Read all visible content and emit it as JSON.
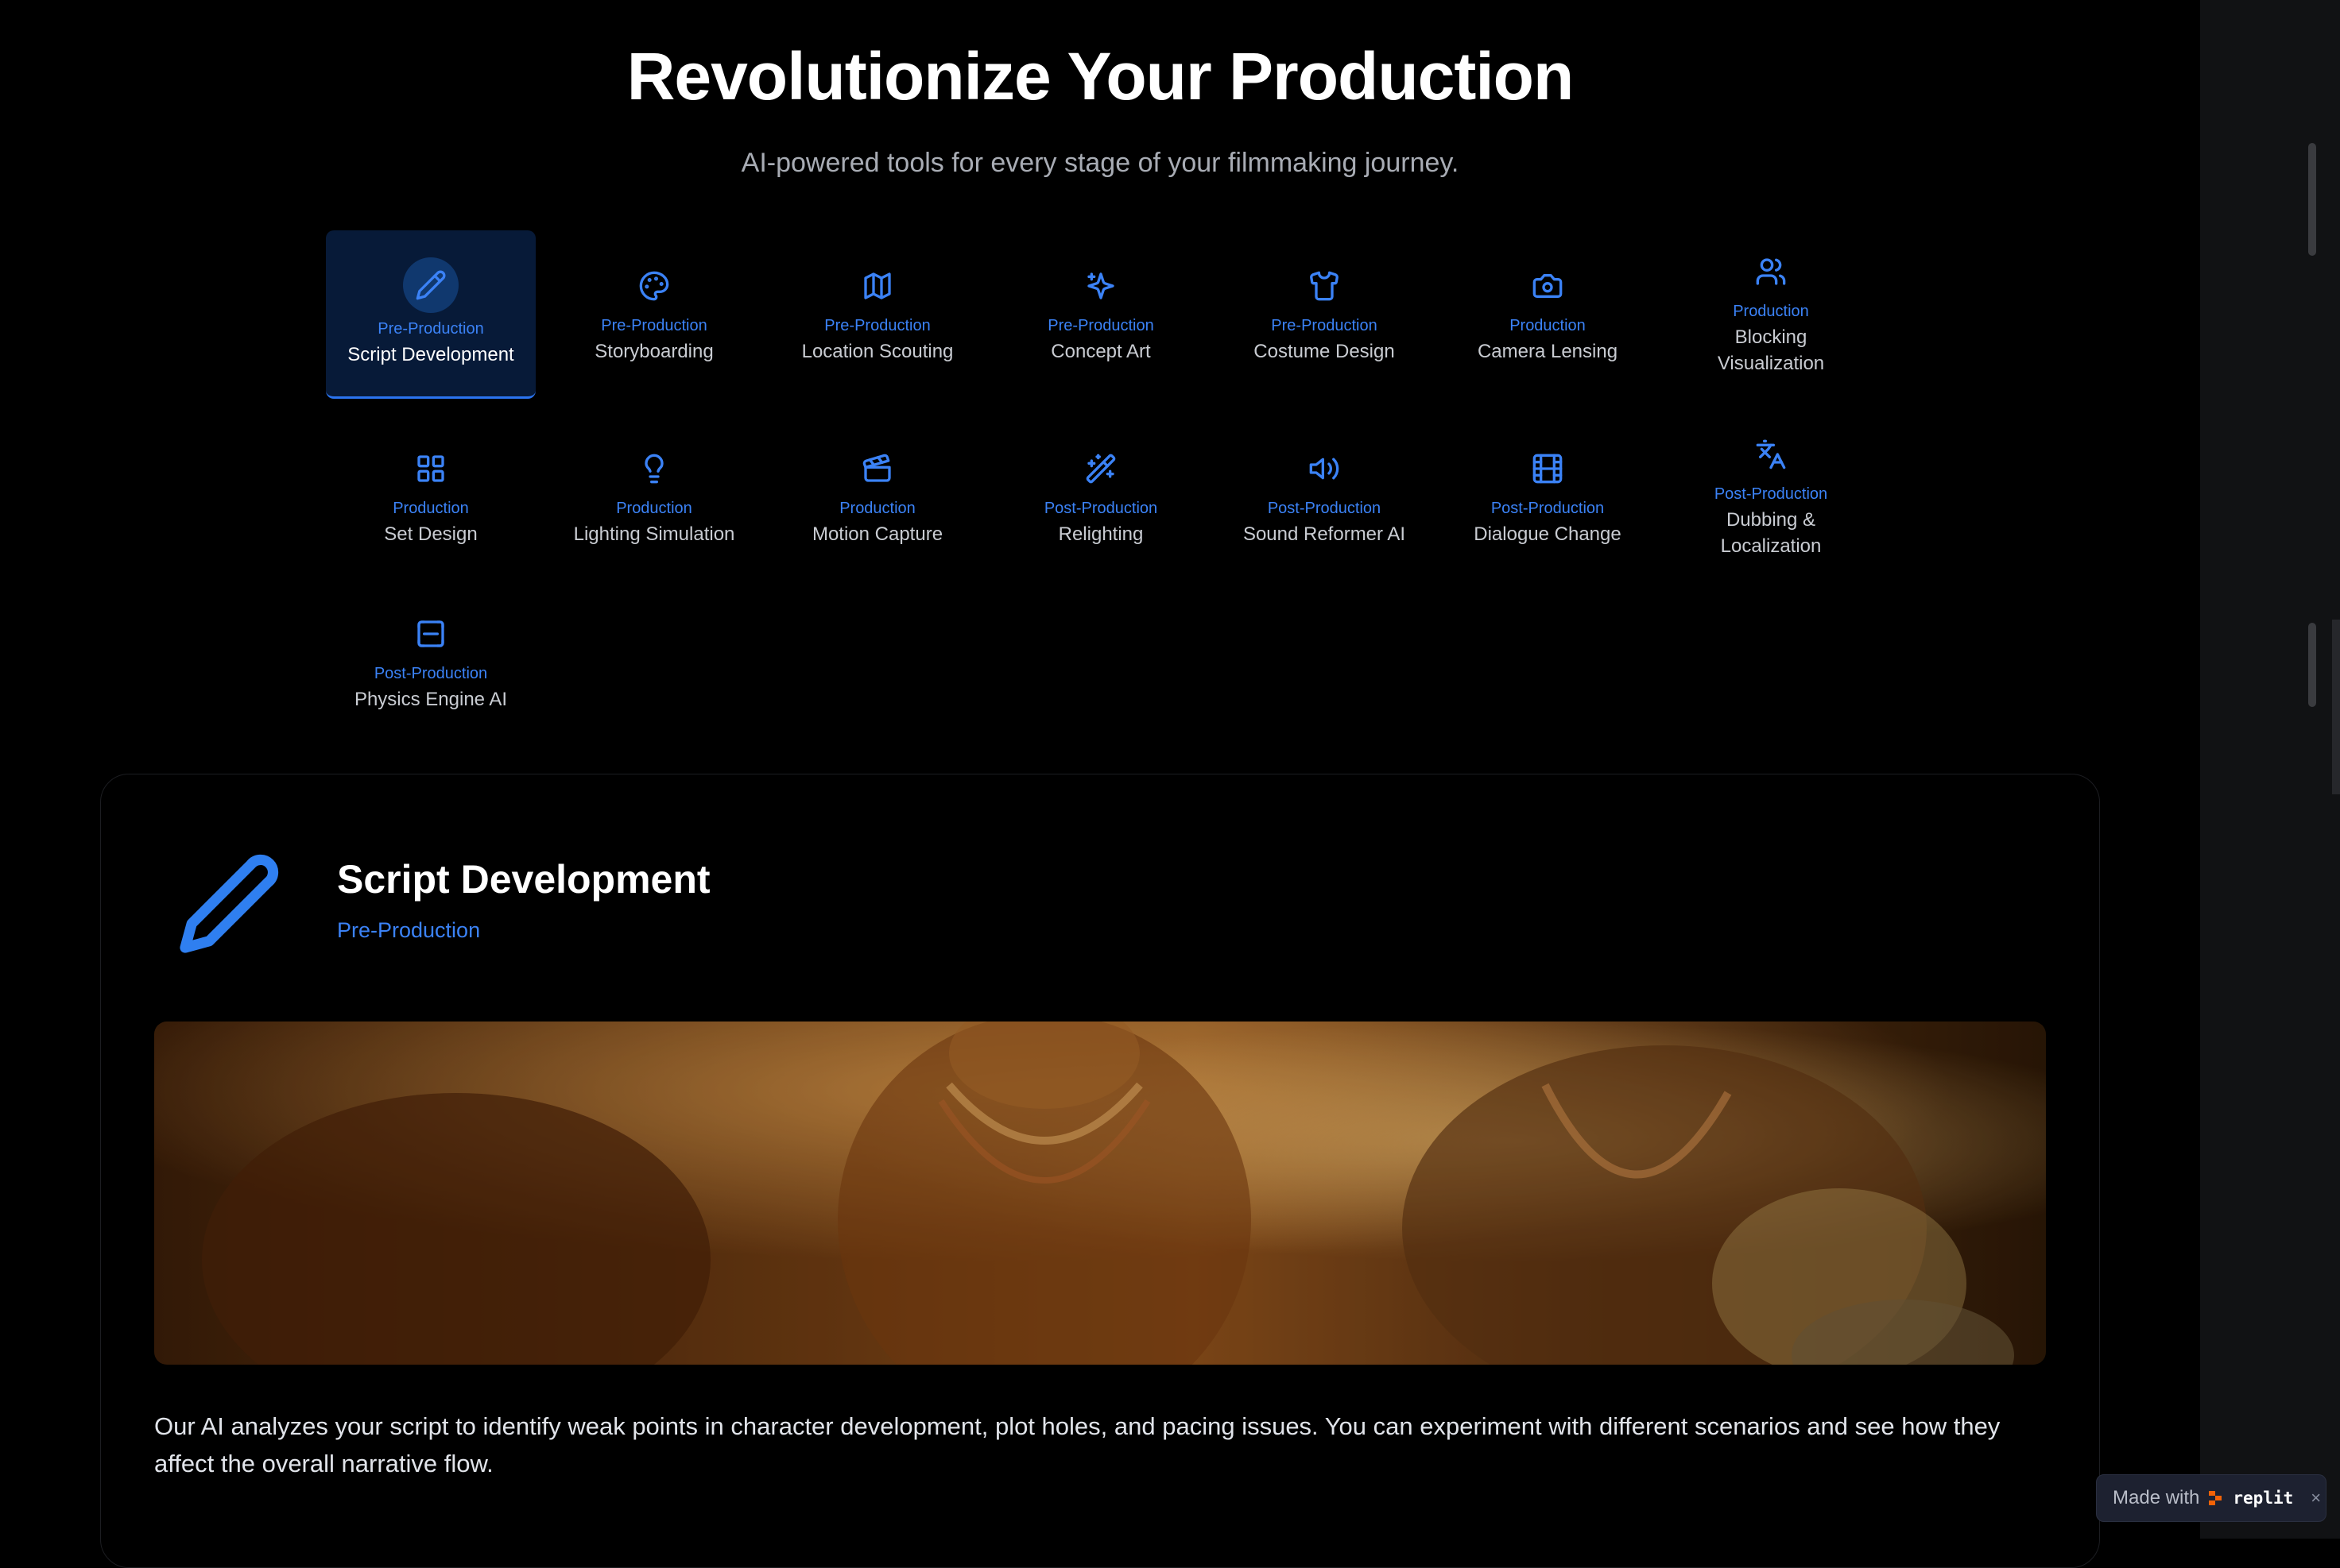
{
  "header": {
    "title": "Revolutionize Your Production",
    "subtitle": "AI-powered tools for every stage of your filmmaking journey."
  },
  "tools": [
    {
      "stage": "Pre-Production",
      "name": "Script Development",
      "icon": "pencil-icon",
      "active": true
    },
    {
      "stage": "Pre-Production",
      "name": "Storyboarding",
      "icon": "palette-icon"
    },
    {
      "stage": "Pre-Production",
      "name": "Location Scouting",
      "icon": "map-icon"
    },
    {
      "stage": "Pre-Production",
      "name": "Concept Art",
      "icon": "sparkles-icon"
    },
    {
      "stage": "Pre-Production",
      "name": "Costume Design",
      "icon": "shirt-icon"
    },
    {
      "stage": "Production",
      "name": "Camera Lensing",
      "icon": "camera-icon"
    },
    {
      "stage": "Production",
      "name": "Blocking Visualization",
      "icon": "users-icon"
    },
    {
      "stage": "Production",
      "name": "Set Design",
      "icon": "grid-icon"
    },
    {
      "stage": "Production",
      "name": "Lighting Simulation",
      "icon": "lightbulb-icon"
    },
    {
      "stage": "Production",
      "name": "Motion Capture",
      "icon": "clapperboard-icon"
    },
    {
      "stage": "Post-Production",
      "name": "Relighting",
      "icon": "magic-wand-icon"
    },
    {
      "stage": "Post-Production",
      "name": "Sound Reformer AI",
      "icon": "volume-icon"
    },
    {
      "stage": "Post-Production",
      "name": "Dialogue Change",
      "icon": "film-icon"
    },
    {
      "stage": "Post-Production",
      "name": "Dubbing & Localization",
      "icon": "languages-icon"
    },
    {
      "stage": "Post-Production",
      "name": "Physics Engine AI",
      "icon": "scan-icon"
    }
  ],
  "detail": {
    "title": "Script Development",
    "stage": "Pre-Production",
    "icon": "pencil-icon",
    "image_alt": "cinematic-still",
    "description": "Our AI analyzes your script to identify weak points in character development, plot holes, and pacing issues. You can experiment with different scenarios and see how they affect the overall narrative flow."
  },
  "badge": {
    "made_with": "Made with",
    "brand": "replit",
    "close": "×"
  },
  "colors": {
    "accent": "#3b82f6",
    "active_tile_bg": "#071a38",
    "background": "#000000"
  }
}
